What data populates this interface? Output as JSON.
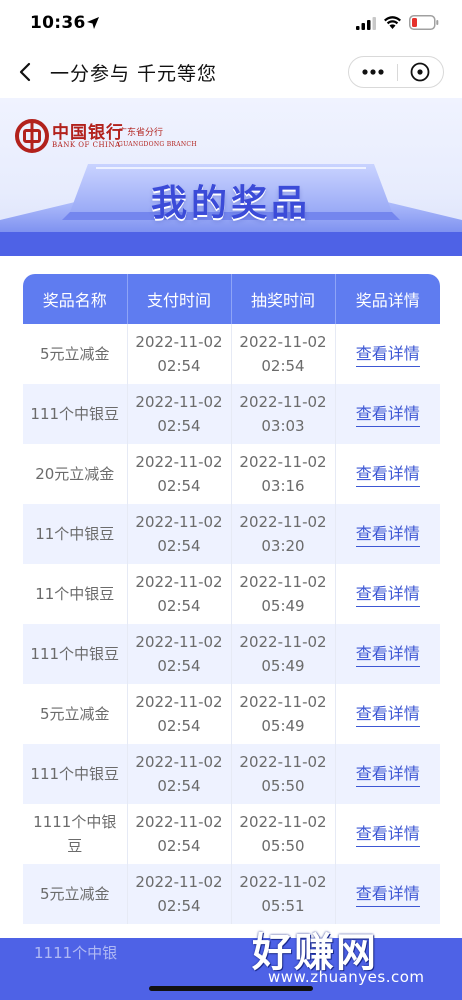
{
  "status_bar": {
    "time": "10:36"
  },
  "nav": {
    "title": "一分参与 千元等您"
  },
  "banner": {
    "bank_name_cn": "中国银行",
    "bank_name_en": "BANK OF CHINA",
    "branch_cn": "广东省分行",
    "branch_en": "GUANGDONG BRANCH",
    "title": "我的奖品"
  },
  "table": {
    "headers": [
      "奖品名称",
      "支付时间",
      "抽奖时间",
      "奖品详情"
    ],
    "detail_link": "查看详情",
    "rows": [
      {
        "name": "5元立减金",
        "pay_date": "2022-11-02",
        "pay_time": "02:54",
        "draw_date": "2022-11-02",
        "draw_time": "02:54"
      },
      {
        "name": "111个中银豆",
        "pay_date": "2022-11-02",
        "pay_time": "02:54",
        "draw_date": "2022-11-02",
        "draw_time": "03:03"
      },
      {
        "name": "20元立减金",
        "pay_date": "2022-11-02",
        "pay_time": "02:54",
        "draw_date": "2022-11-02",
        "draw_time": "03:16"
      },
      {
        "name": "11个中银豆",
        "pay_date": "2022-11-02",
        "pay_time": "02:54",
        "draw_date": "2022-11-02",
        "draw_time": "03:20"
      },
      {
        "name": "11个中银豆",
        "pay_date": "2022-11-02",
        "pay_time": "02:54",
        "draw_date": "2022-11-02",
        "draw_time": "05:49"
      },
      {
        "name": "111个中银豆",
        "pay_date": "2022-11-02",
        "pay_time": "02:54",
        "draw_date": "2022-11-02",
        "draw_time": "05:49"
      },
      {
        "name": "5元立减金",
        "pay_date": "2022-11-02",
        "pay_time": "02:54",
        "draw_date": "2022-11-02",
        "draw_time": "05:49"
      },
      {
        "name": "111个中银豆",
        "pay_date": "2022-11-02",
        "pay_time": "02:54",
        "draw_date": "2022-11-02",
        "draw_time": "05:50"
      },
      {
        "name": "1111个中银豆",
        "pay_date": "2022-11-02",
        "pay_time": "02:54",
        "draw_date": "2022-11-02",
        "draw_time": "05:50"
      },
      {
        "name": "5元立减金",
        "pay_date": "2022-11-02",
        "pay_time": "02:54",
        "draw_date": "2022-11-02",
        "draw_time": "05:51"
      }
    ]
  },
  "bottom": {
    "ghost_text": "1111个中银"
  },
  "watermark": {
    "text": "好赚网",
    "url": "www.zhuanyes.com"
  },
  "colors": {
    "accent": "#5f7cf0",
    "bar": "#4e62e6",
    "link": "#3e58d4",
    "row_alt": "#eef2ff",
    "brand_red": "#b2211c"
  }
}
